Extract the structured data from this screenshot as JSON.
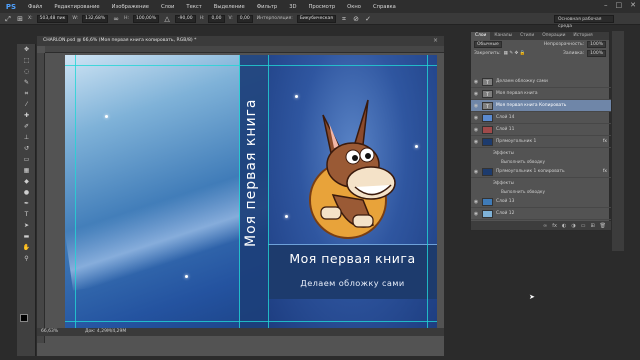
{
  "app": {
    "logo": "PS",
    "menu": [
      "Файл",
      "Редактирование",
      "Изображение",
      "Слои",
      "Текст",
      "Выделение",
      "Фильтр",
      "3D",
      "Просмотр",
      "Окно",
      "Справка"
    ],
    "window_controls": [
      "–",
      "□",
      "✕"
    ]
  },
  "options": {
    "x": "503,48 пик",
    "w": "132,68%",
    "h": "100,00%",
    "angle": "-90,00",
    "h_skew": "0,00",
    "v_skew": "0,00",
    "interp_label": "Интерполяция:",
    "interp_value": "Бикубическая",
    "workspace": "Основная рабочая среда"
  },
  "document": {
    "tab_title": "CHARLON.psd @ 66,6% (Моя первая книга копировать, RGB/8) *",
    "tab_close": "×",
    "zoom": "66,63%",
    "doc_size": "Док: 4,29М/4,29М"
  },
  "cover": {
    "spine_title": "Моя первая книга",
    "title": "Моя первая книга",
    "subtitle": "Делаем обложку сами"
  },
  "panel": {
    "tabs": [
      "Слои",
      "Каналы",
      "Стили",
      "Операции",
      "История"
    ],
    "kind_label": "Обычные",
    "opacity_label": "Непрозрачность:",
    "opacity_value": "100%",
    "lock_label": "Закрепить:",
    "fill_label": "Заливка:",
    "fill_value": "100%",
    "layers": [
      {
        "name": "Делаем обложку сами",
        "thumb": "T",
        "selected": false
      },
      {
        "name": "Моя первая книга",
        "thumb": "T",
        "selected": false
      },
      {
        "name": "Моя первая книга Копировать",
        "thumb": "T",
        "selected": true
      },
      {
        "name": "Слой 14",
        "thumb": "",
        "selected": false
      },
      {
        "name": "Слой 11",
        "thumb": "",
        "selected": false
      },
      {
        "name": "Прямоугольник 1",
        "thumb": "",
        "selected": false,
        "fx": "fx"
      },
      {
        "name": "Прямоугольник 1 копировать",
        "thumb": "",
        "selected": false,
        "fx": "fx"
      },
      {
        "name": "Слой 13",
        "thumb": "",
        "selected": false
      },
      {
        "name": "Слой 12",
        "thumb": "",
        "selected": false
      }
    ],
    "effects_label": "Эффекты",
    "stroke_label": "Выполнить обводку",
    "footer_icons": [
      "link-icon",
      "fx-icon",
      "mask-icon",
      "adjust-icon",
      "folder-icon",
      "new-layer-icon",
      "trash-icon"
    ]
  }
}
